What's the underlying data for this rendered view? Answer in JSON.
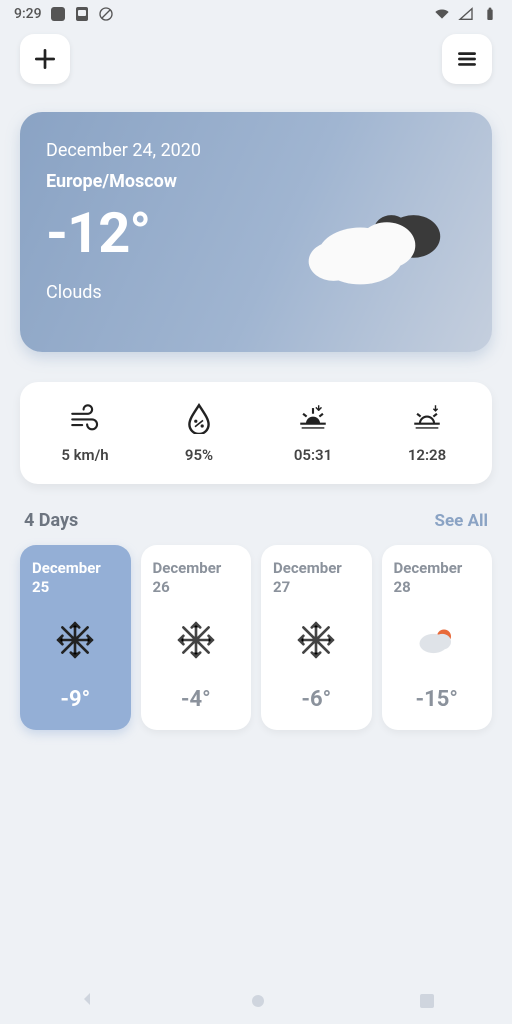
{
  "status": {
    "time": "9:29"
  },
  "main": {
    "date": "December 24, 2020",
    "location": "Europe/Moscow",
    "temp": "-12°",
    "condition": "Clouds"
  },
  "stats": {
    "wind": "5 km/h",
    "humidity": "95%",
    "sunrise": "05:31",
    "sunset": "12:28"
  },
  "forecast": {
    "title": "4 Days",
    "see_all": "See All",
    "days": [
      {
        "date": "December 25",
        "temp": "-9°",
        "icon": "snow"
      },
      {
        "date": "December 26",
        "temp": "-4°",
        "icon": "snow"
      },
      {
        "date": "December 27",
        "temp": "-6°",
        "icon": "snow"
      },
      {
        "date": "December 28",
        "temp": "-15°",
        "icon": "suncloud"
      }
    ]
  },
  "colors": {
    "accent": "#8aa3c4",
    "selected": "#94afd6",
    "bg": "#eef1f5",
    "muted": "#8b929c"
  }
}
